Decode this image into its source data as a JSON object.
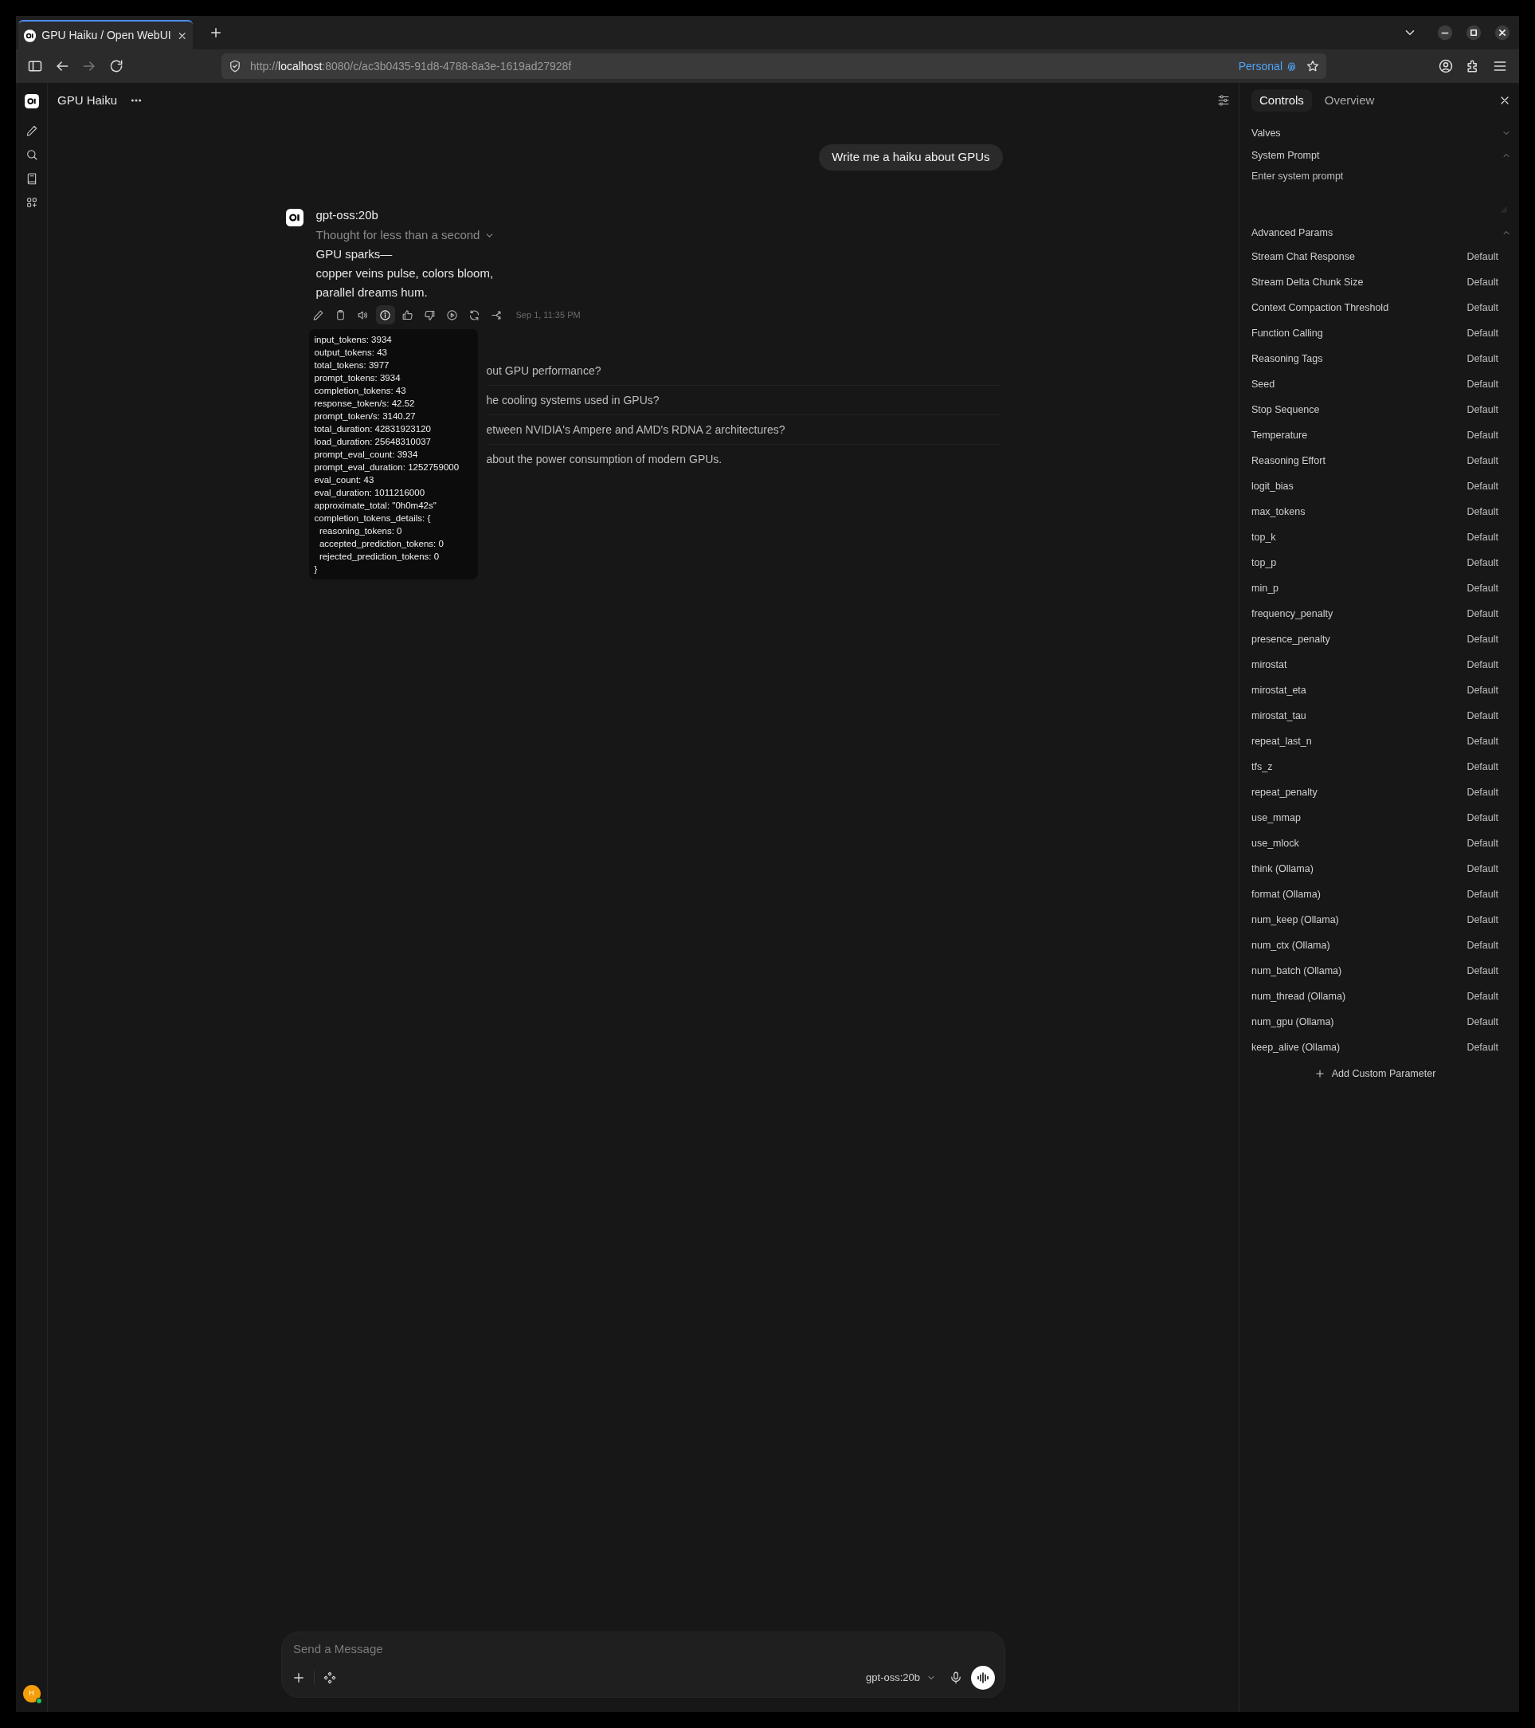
{
  "browser": {
    "tabs": [
      {
        "title": "GPU Haiku / Open WebUI",
        "selected": true
      }
    ],
    "url": {
      "scheme": "http://",
      "host": "localhost",
      "rest": ":8080/c/ac3b0435-91d8-4788-8a3e-1619ad27928f"
    },
    "container": "Personal"
  },
  "chat": {
    "title": "GPU Haiku",
    "user_message": "Write me a haiku about GPUs",
    "assistant": {
      "model": "gpt-oss:20b",
      "thought": "Thought for less than a second",
      "lines": [
        "GPU sparks—",
        "copper veins pulse, colors bloom,",
        "parallel dreams hum."
      ],
      "actions": [
        {
          "kind": "edit",
          "selected": false
        },
        {
          "kind": "copy",
          "selected": false
        },
        {
          "kind": "speak",
          "selected": false
        },
        {
          "kind": "info",
          "selected": true
        },
        {
          "kind": "like",
          "selected": false
        },
        {
          "kind": "dislike",
          "selected": false
        },
        {
          "kind": "continue",
          "selected": false
        },
        {
          "kind": "regenerate",
          "selected": false
        },
        {
          "kind": "branch",
          "selected": false
        }
      ],
      "timestamp": "Sep 1, 11:35 PM",
      "usage_tooltip": [
        "input_tokens: 3934",
        "output_tokens: 43",
        "total_tokens: 3977",
        "prompt_tokens: 3934",
        "completion_tokens: 43",
        "response_token/s: 42.52",
        "prompt_token/s: 3140.27",
        "total_duration: 42831923120",
        "load_duration: 25648310037",
        "prompt_eval_count: 3934",
        "prompt_eval_duration: 1252759000",
        "eval_count: 43",
        "eval_duration: 1011216000",
        "approximate_total: \"0h0m42s\"",
        "completion_tokens_details: {",
        "  reasoning_tokens: 0",
        "  accepted_prediction_tokens: 0",
        "  rejected_prediction_tokens: 0",
        "}"
      ]
    },
    "follow_ups": [
      "out GPU performance?",
      "he cooling systems used in GPUs?",
      "etween NVIDIA's Ampere and AMD's RDNA 2 architectures?",
      "about the power consumption of modern GPUs."
    ]
  },
  "input": {
    "placeholder": "Send a Message",
    "model": "gpt-oss:20b"
  },
  "user": {
    "initial": "H",
    "online": true
  },
  "controls_panel": {
    "tabs": [
      {
        "label": "Controls",
        "selected": true
      },
      {
        "label": "Overview",
        "selected": false
      }
    ],
    "sections": [
      {
        "title": "Valves",
        "expanded": false
      },
      {
        "title": "System Prompt",
        "expanded": true,
        "placeholder": "Enter system prompt"
      },
      {
        "title": "Advanced Params",
        "expanded": true,
        "params": [
          {
            "label": "Stream Chat Response",
            "value": "Default"
          },
          {
            "label": "Stream Delta Chunk Size",
            "value": "Default"
          },
          {
            "label": "Context Compaction Threshold",
            "value": "Default"
          },
          {
            "label": "Function Calling",
            "value": "Default"
          },
          {
            "label": "Reasoning Tags",
            "value": "Default"
          },
          {
            "label": "Seed",
            "value": "Default"
          },
          {
            "label": "Stop Sequence",
            "value": "Default"
          },
          {
            "label": "Temperature",
            "value": "Default"
          },
          {
            "label": "Reasoning Effort",
            "value": "Default"
          },
          {
            "label": "logit_bias",
            "value": "Default"
          },
          {
            "label": "max_tokens",
            "value": "Default"
          },
          {
            "label": "top_k",
            "value": "Default"
          },
          {
            "label": "top_p",
            "value": "Default"
          },
          {
            "label": "min_p",
            "value": "Default"
          },
          {
            "label": "frequency_penalty",
            "value": "Default"
          },
          {
            "label": "presence_penalty",
            "value": "Default"
          },
          {
            "label": "mirostat",
            "value": "Default"
          },
          {
            "label": "mirostat_eta",
            "value": "Default"
          },
          {
            "label": "mirostat_tau",
            "value": "Default"
          },
          {
            "label": "repeat_last_n",
            "value": "Default"
          },
          {
            "label": "tfs_z",
            "value": "Default"
          },
          {
            "label": "repeat_penalty",
            "value": "Default"
          },
          {
            "label": "use_mmap",
            "value": "Default"
          },
          {
            "label": "use_mlock",
            "value": "Default"
          },
          {
            "label": "think (Ollama)",
            "value": "Default"
          },
          {
            "label": "format (Ollama)",
            "value": "Default"
          },
          {
            "label": "num_keep (Ollama)",
            "value": "Default"
          },
          {
            "label": "num_ctx (Ollama)",
            "value": "Default"
          },
          {
            "label": "num_batch (Ollama)",
            "value": "Default"
          },
          {
            "label": "num_thread (Ollama)",
            "value": "Default"
          },
          {
            "label": "num_gpu (Ollama)",
            "value": "Default"
          },
          {
            "label": "keep_alive (Ollama)",
            "value": "Default"
          }
        ]
      }
    ],
    "add_button": "Add Custom Parameter"
  }
}
